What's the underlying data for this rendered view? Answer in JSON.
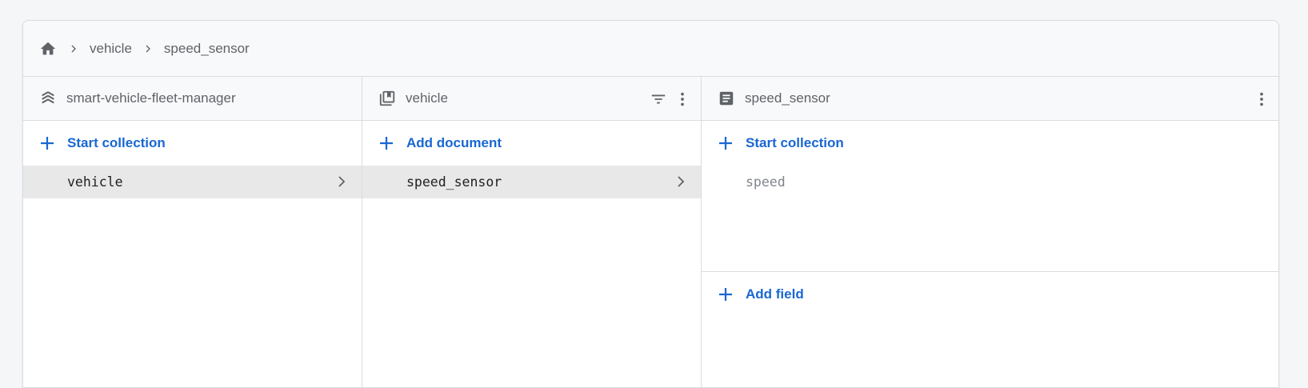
{
  "breadcrumb": {
    "home_icon": "home-icon",
    "items": [
      {
        "label": "vehicle"
      },
      {
        "label": "speed_sensor"
      }
    ]
  },
  "columns": {
    "root": {
      "icon": "database-stack-icon",
      "title": "smart-vehicle-fleet-manager",
      "action_label": "Start collection",
      "items": [
        {
          "label": "vehicle",
          "selected": true
        }
      ]
    },
    "collection": {
      "icon": "collection-icon",
      "title": "vehicle",
      "actions": [
        "filter-icon",
        "more-vert-icon"
      ],
      "action_label": "Add document",
      "items": [
        {
          "label": "speed_sensor",
          "selected": true
        }
      ]
    },
    "document": {
      "icon": "document-icon",
      "title": "speed_sensor",
      "actions": [
        "more-vert-icon"
      ],
      "action_label": "Start collection",
      "fields": [
        {
          "label": "speed"
        }
      ],
      "add_field_label": "Add field"
    }
  },
  "colors": {
    "accent": "#1967d2",
    "muted_text": "#5f6368",
    "selected_row": "#e8e8e8",
    "border": "#dadce0",
    "header_bg": "#f8f9fa"
  }
}
